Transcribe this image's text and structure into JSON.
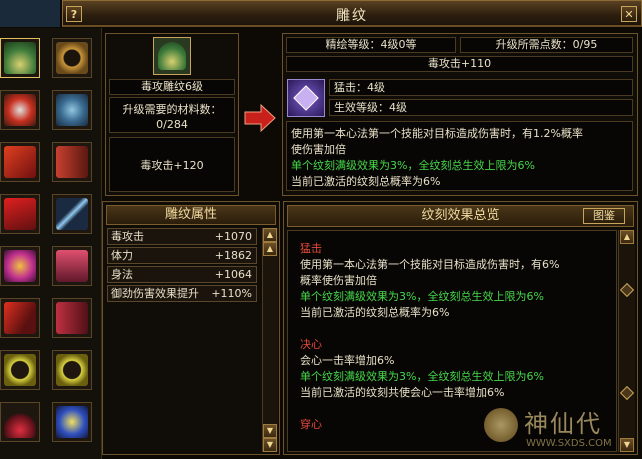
{
  "window": {
    "title": "雕纹",
    "help_label": "?",
    "close_label": "✕"
  },
  "item_icons": [
    "fan-icon",
    "ring-icon",
    "mask-icon",
    "bracelet-icon",
    "hat-icon",
    "bracer-icon",
    "sash-icon",
    "feather-icon",
    "armor-icon",
    "glove-icon",
    "cape-icon",
    "boots-icon",
    "necklace-icon",
    "necklace-icon",
    "amulet-icon",
    "jewel-icon"
  ],
  "current": {
    "icon": "fan-icon",
    "name": "毒攻雕纹6级",
    "materials_label": "升级需要的材料数：",
    "materials_value": "0/284",
    "stat": "毒攻击+120"
  },
  "upgrade": {
    "refine_level": "精绘等级：4级0等",
    "points_needed": "升级所需点数：0/95",
    "stat": "毒攻击+110",
    "skill_name": "猛击：4级",
    "effect_level": "生效等级：4级",
    "desc_line1": "使用第一本心法第一个技能对目标造成伤害时，有1.2%概率",
    "desc_line2": "使伤害加倍",
    "desc_line3": "单个纹刻满级效果为3%，全纹刻总生效上限为6%",
    "desc_line4": "当前已激活的纹刻总概率为6%"
  },
  "attributes": {
    "title": "雕纹属性",
    "rows": [
      {
        "name": "毒攻击",
        "value": "+1070"
      },
      {
        "name": "体力",
        "value": "+1862"
      },
      {
        "name": "身法",
        "value": "+1064"
      },
      {
        "name": "御劲伤害效果提升",
        "value": "+110%"
      }
    ]
  },
  "summary": {
    "title": "纹刻效果总览",
    "gallery_button": "图鉴",
    "lines": [
      {
        "text": "猛击",
        "style": "red"
      },
      {
        "text": "使用第一本心法第一个技能对目标造成伤害时，有6%",
        "style": "white"
      },
      {
        "text": "概率使伤害加倍",
        "style": "white"
      },
      {
        "text": "单个纹刻满级效果为3%，全纹刻总生效上限为6%",
        "style": "green"
      },
      {
        "text": "当前已激活的纹刻总概率为6%",
        "style": "white"
      },
      {
        "text": "",
        "style": "white"
      },
      {
        "text": "决心",
        "style": "red"
      },
      {
        "text": "会心一击率增加6%",
        "style": "white"
      },
      {
        "text": "单个纹刻满级效果为3%，全纹刻总生效上限为6%",
        "style": "green"
      },
      {
        "text": "当前已激活的纹刻共使会心一击率增加6%",
        "style": "white"
      },
      {
        "text": "",
        "style": "white"
      },
      {
        "text": "穿心",
        "style": "red"
      }
    ]
  },
  "watermark": {
    "brand": "神仙代",
    "url": "WWW.SXDS.COM"
  }
}
